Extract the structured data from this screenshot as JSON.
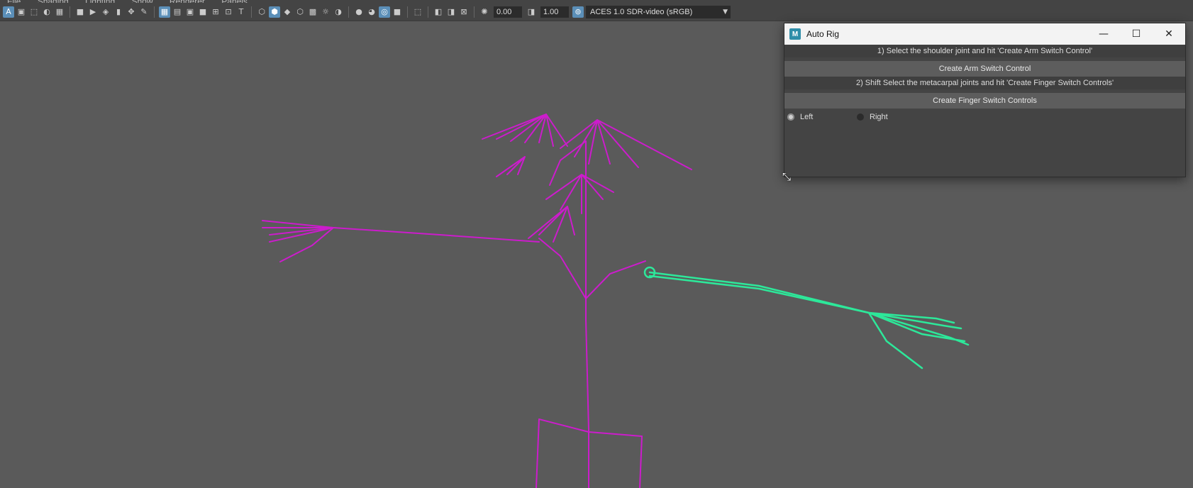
{
  "menu": {
    "items": [
      "File",
      "Shading",
      "Lighting",
      "Show",
      "Renderer",
      "Panels"
    ]
  },
  "toolbar": {
    "exposure_value": "0.00",
    "gamma_value": "1.00",
    "color_space": "ACES 1.0 SDR-video (sRGB)",
    "icons": [
      "select-camera-icon",
      "camera-attributes-icon",
      "bookmarks-icon",
      "image-plane-icon",
      "2d-pan-icon",
      "film-gate-icon",
      "resolution-gate-icon",
      "gate-mask-icon",
      "field-chart-icon",
      "safe-action-icon",
      "safe-title-icon",
      "wireframe-icon",
      "smooth-shade-icon",
      "wireframe-on-shaded-icon",
      "textured-icon",
      "lighting-icon",
      "shadows-icon",
      "screen-space-ao-icon",
      "motion-blur-icon",
      "anti-aliasing-icon",
      "depth-of-field-icon",
      "isolate-select-icon",
      "xray-icon",
      "xray-joints-icon",
      "xray-components-icon"
    ]
  },
  "colors": {
    "viewport_bg": "#5a5a5a",
    "skeleton": "#cc1ccc",
    "selected_arm": "#2de89a",
    "accent": "#5b8fb8"
  },
  "autorig": {
    "title": "Auto Rig",
    "instruction_1": "1) Select the shoulder joint and hit 'Create Arm Switch Control'",
    "arm_button": "Create Arm Switch Control",
    "instruction_2": "2) Shift Select the metacarpal joints and hit 'Create Finger Switch Controls'",
    "finger_button": "Create Finger Switch Controls",
    "side_options": [
      {
        "label": "Left",
        "checked": true
      },
      {
        "label": "Right",
        "checked": false
      }
    ]
  }
}
